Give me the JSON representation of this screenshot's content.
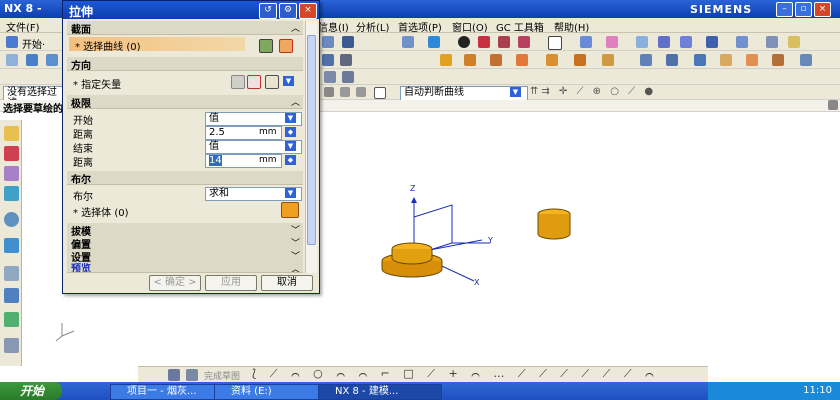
{
  "app": {
    "title": "NX 8 -",
    "brand": "SIEMENS",
    "window_buttons": [
      "–",
      "▫",
      "×"
    ]
  },
  "menu": {
    "items": [
      "文件(F)",
      "信息(I)",
      "分析(L)",
      "首选项(P)",
      "窗口(O)",
      "GC 工具箱",
      "帮助(H)"
    ]
  },
  "toolbar": {
    "start_label": "开始·",
    "filter_text": "没有选择过滤",
    "sketch_text": "选择要草绘的",
    "curve_rule": "自动判断曲线"
  },
  "dialog": {
    "title": "拉伸",
    "section_label": "截面",
    "select_curve": "* 选择曲线 (0)",
    "direction_label": "方向",
    "specify_vector": "* 指定矢量",
    "limits_label": "极限",
    "start_label": "开始",
    "start_value": "值",
    "distance1_label": "距离",
    "distance1_value": "2.5",
    "distance1_unit": "mm",
    "end_label": "结束",
    "end_value": "值",
    "distance2_label": "距离",
    "distance2_value": "14",
    "distance2_unit": "mm",
    "boolean_section": "布尔",
    "boolean_label": "布尔",
    "boolean_value": "求和",
    "select_body": "* 选择体 (0)",
    "draft_label": "拔模",
    "offset_label": "偏置",
    "settings_label": "设置",
    "preview_label": "预览",
    "ok_label": "< 确定 >",
    "apply_label": "应用",
    "cancel_label": "取消"
  },
  "bottombar": {
    "sketch_done": "完成草图"
  },
  "taskbar": {
    "start": "开始",
    "tasks": [
      "项目一 - 烟灰...",
      "资料 (E:)",
      "NX 8 - 建模..."
    ],
    "clock": "11:10"
  },
  "colors": {
    "title_blue": "#0d3fb0",
    "part_orange": "#e89f10",
    "axis_blue": "#1a2db8"
  }
}
